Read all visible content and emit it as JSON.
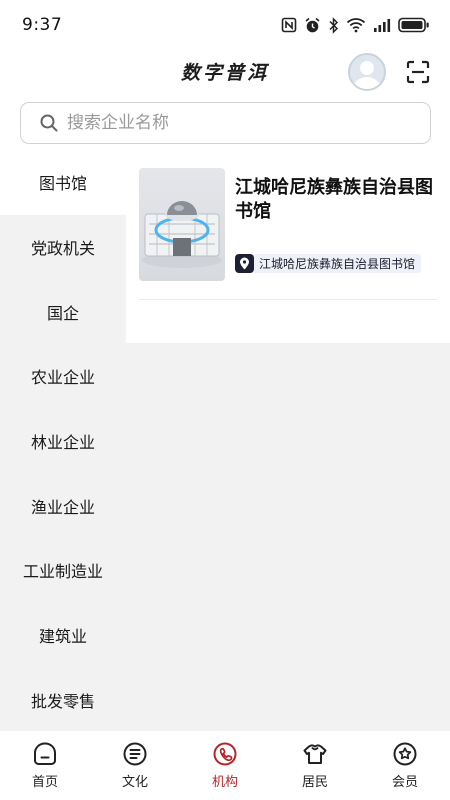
{
  "status_bar": {
    "time": "9:37"
  },
  "header": {
    "title": "数字普洱"
  },
  "search": {
    "placeholder": "搜索企业名称"
  },
  "categories": [
    {
      "label": "图书馆",
      "active": true
    },
    {
      "label": "党政机关",
      "active": false
    },
    {
      "label": "国企",
      "active": false
    },
    {
      "label": "农业企业",
      "active": false
    },
    {
      "label": "林业企业",
      "active": false
    },
    {
      "label": "渔业企业",
      "active": false
    },
    {
      "label": "工业制造业",
      "active": false
    },
    {
      "label": "建筑业",
      "active": false
    },
    {
      "label": "批发零售",
      "active": false
    }
  ],
  "organizations": [
    {
      "name": "江城哈尼族彝族自治县图书馆",
      "tag": "江城哈尼族彝族自治县图书馆",
      "image_icon": "library-building-image"
    }
  ],
  "bottom_nav": [
    {
      "label": "首页",
      "icon": "home-icon",
      "active": false
    },
    {
      "label": "文化",
      "icon": "culture-icon",
      "active": false
    },
    {
      "label": "机构",
      "icon": "institution-icon",
      "active": true
    },
    {
      "label": "居民",
      "icon": "resident-icon",
      "active": false
    },
    {
      "label": "会员",
      "icon": "member-icon",
      "active": false
    }
  ],
  "colors": {
    "accent": "#b3262a",
    "sidebar_bg": "#f2f2f2",
    "tag_bg": "#eef2f8"
  }
}
